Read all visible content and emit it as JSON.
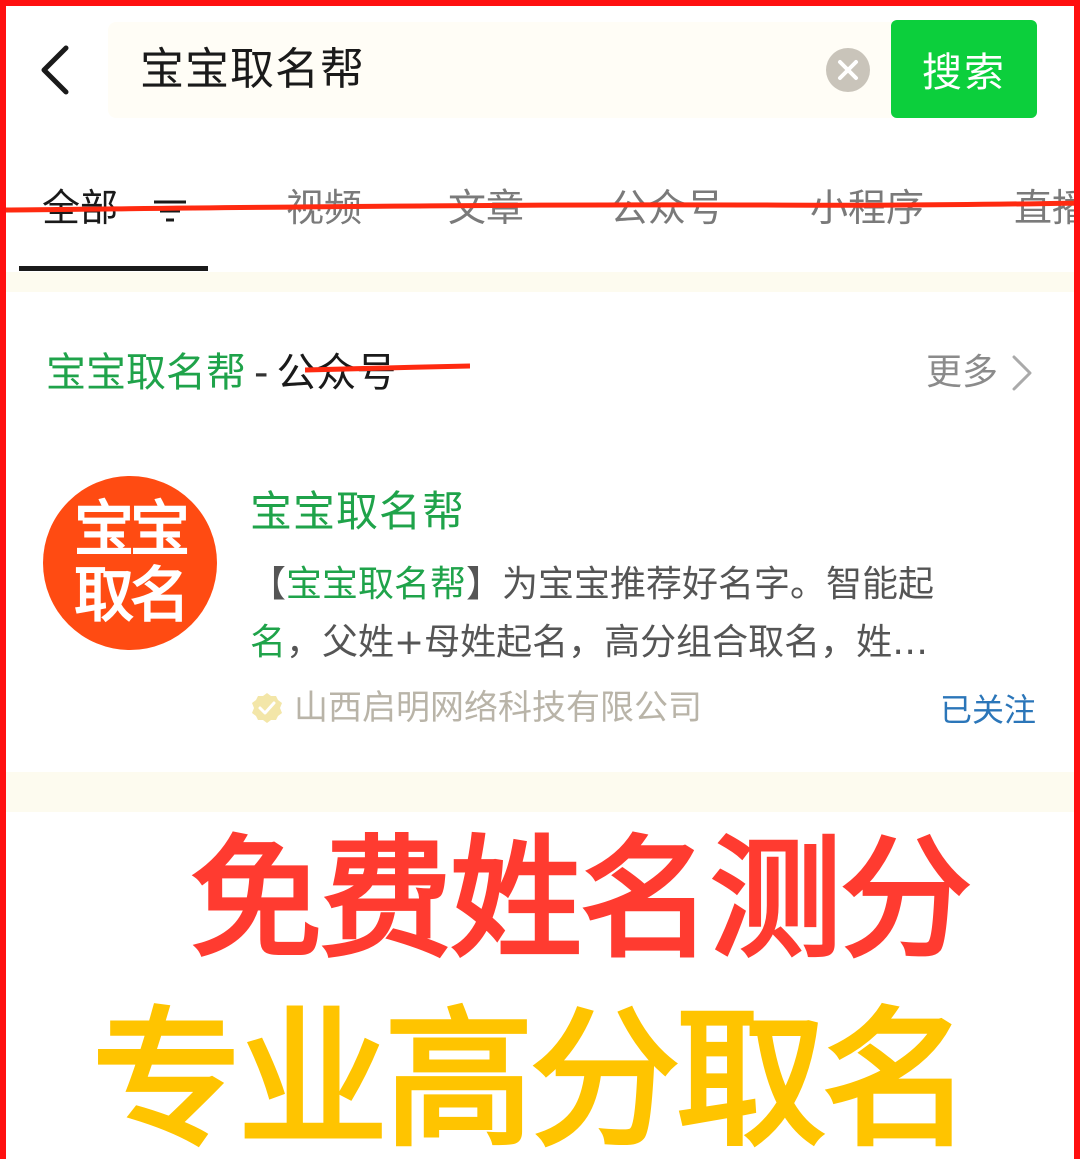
{
  "search": {
    "query": "宝宝取名帮",
    "button_label": "搜索"
  },
  "tabs": [
    {
      "label": "全部"
    },
    {
      "label": "视频"
    },
    {
      "label": "文章"
    },
    {
      "label": "公众号"
    },
    {
      "label": "小程序"
    },
    {
      "label": "直播"
    }
  ],
  "section": {
    "name": "宝宝取名帮",
    "dash": "-",
    "category": "公众号",
    "more_label": "更多"
  },
  "account": {
    "avatar_line1": "宝宝",
    "avatar_line2": "取名",
    "name": "宝宝取名帮",
    "desc_line1_prefix": "【",
    "desc_line1_highlight": "宝宝取名帮",
    "desc_line1_rest": "】为宝宝推荐好名字。智能起",
    "desc_line2_highlight": "名",
    "desc_line2_rest": "，父姓+母姓起名，高分组合取名，姓…",
    "company": "山西启明网络科技有限公司",
    "follow_status": "已关注"
  },
  "promo": {
    "line1": "免费姓名测分",
    "line2": "专业高分取名"
  },
  "colors": {
    "frame": "#ff1010",
    "search_button": "#0ccf3c",
    "brand_green": "#1fa34a",
    "followed_blue": "#2b76b9",
    "promo_red": "#ff3b30",
    "promo_yellow": "#ffc400",
    "avatar_bg": "#ff4b12"
  }
}
